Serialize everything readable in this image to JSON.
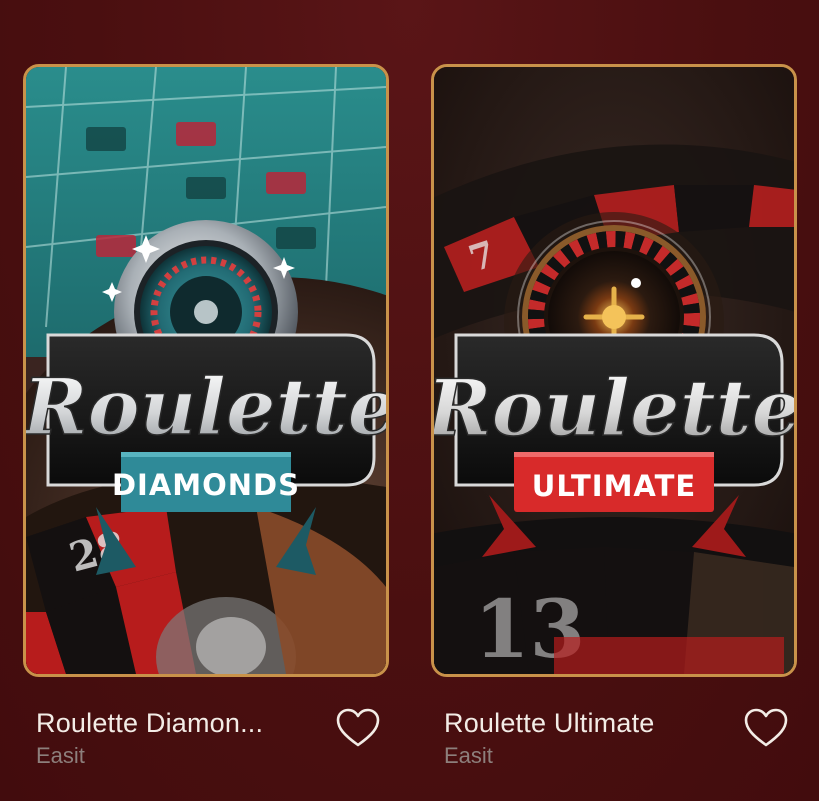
{
  "games": [
    {
      "title_display": "Roulette Diamon...",
      "provider": "Easit",
      "logo_script": "Roulette",
      "logo_banner": "DIAMONDS",
      "banner_color": "#2f8a98",
      "favorite_icon": "heart-outline-icon"
    },
    {
      "title_display": "Roulette Ultimate",
      "provider": "Easit",
      "logo_script": "Roulette",
      "logo_banner": "ULTIMATE",
      "banner_color": "#d82a2a",
      "favorite_icon": "heart-outline-icon"
    }
  ],
  "colors": {
    "background": "#4a0f10",
    "card_border": "#c9924a",
    "title_text": "#f3ece6",
    "provider_text": "#8d7f7c"
  }
}
